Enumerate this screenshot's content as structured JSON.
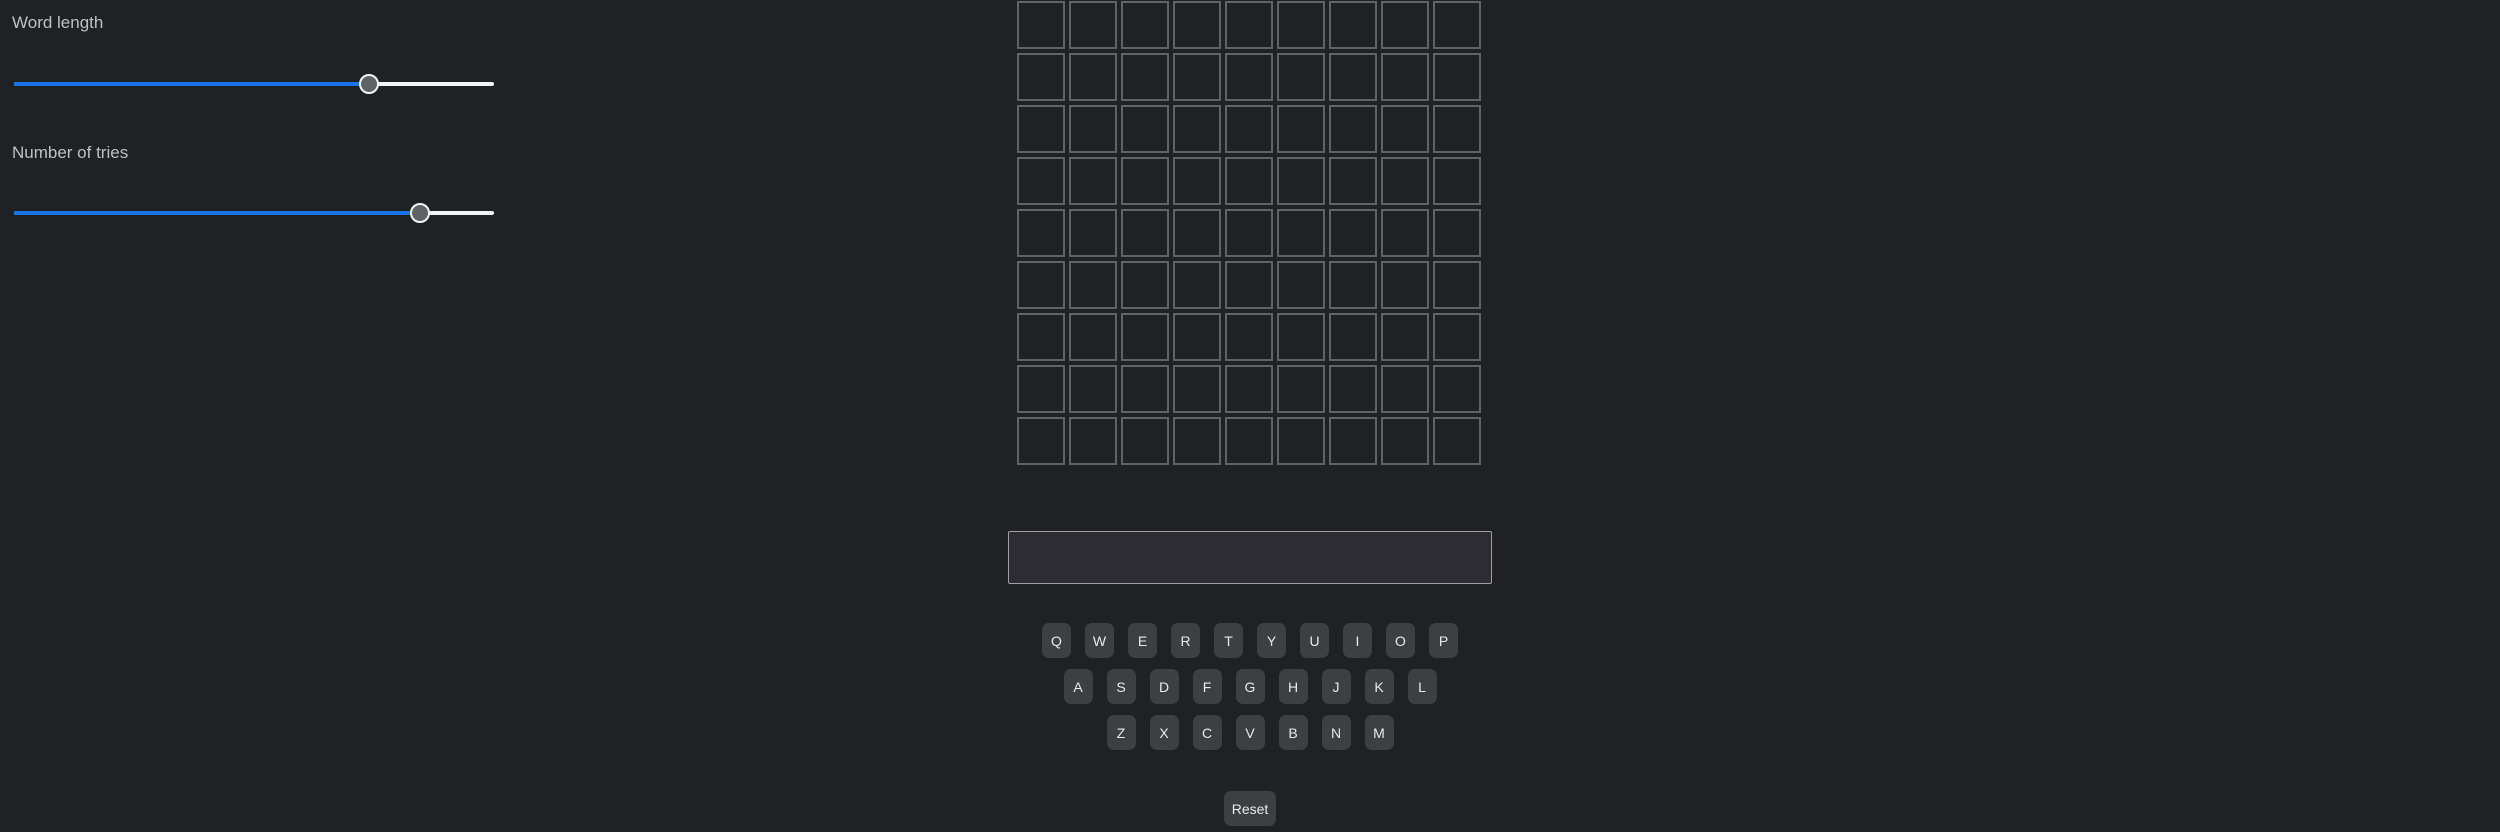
{
  "settings": {
    "word_length": {
      "label": "Word length",
      "value_fraction": 0.74
    },
    "tries": {
      "label": "Number of tries",
      "value_fraction": 0.845
    }
  },
  "board": {
    "rows": 9,
    "cols": 9
  },
  "guess_input": {
    "value": "",
    "placeholder": ""
  },
  "keyboard": {
    "rows": [
      [
        "Q",
        "W",
        "E",
        "R",
        "T",
        "Y",
        "U",
        "I",
        "O",
        "P"
      ],
      [
        "A",
        "S",
        "D",
        "F",
        "G",
        "H",
        "J",
        "K",
        "L"
      ],
      [
        "Z",
        "X",
        "C",
        "V",
        "B",
        "N",
        "M"
      ]
    ]
  },
  "reset_label": "Reset",
  "colors": {
    "background": "#202124",
    "accent": "#1a73e8",
    "tile_border": "#5f6368",
    "key_bg": "#3c4043"
  }
}
